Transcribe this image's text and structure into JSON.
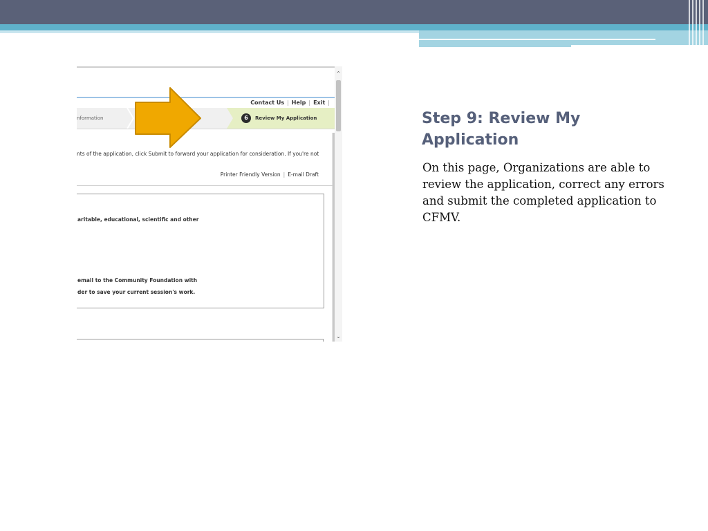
{
  "slide": {
    "title": "Step 9: Review My Application",
    "body": "On this page, Organizations are able to review the application, correct any errors and submit the completed application to CFMV."
  },
  "screenshot": {
    "top_links": [
      "Contact Us",
      "Help",
      "Exit"
    ],
    "steps": {
      "previous_label": "nformation",
      "active_number": "6",
      "active_label": "Review My Application"
    },
    "intro_text": "nts of the application, click Submit to forward your application for consideration. If you're not",
    "utility_links": {
      "printer": "Printer Friendly Version",
      "email": "E-mail Draft"
    },
    "info_lines": [
      "aritable, educational, scientific and other",
      "email to the Community Foundation with",
      "der to save your current session's work."
    ]
  },
  "colors": {
    "header_dark": "#5a6178",
    "header_blue": "#5fb1ca",
    "title": "#56607a",
    "arrow_fill": "#f0a800",
    "arrow_stroke": "#c88a00",
    "active_step_bg": "#e6efc4"
  },
  "icons": {
    "arrow": "right-arrow-icon",
    "scroll_up": "chevron-up-icon",
    "scroll_down": "chevron-down-icon"
  }
}
